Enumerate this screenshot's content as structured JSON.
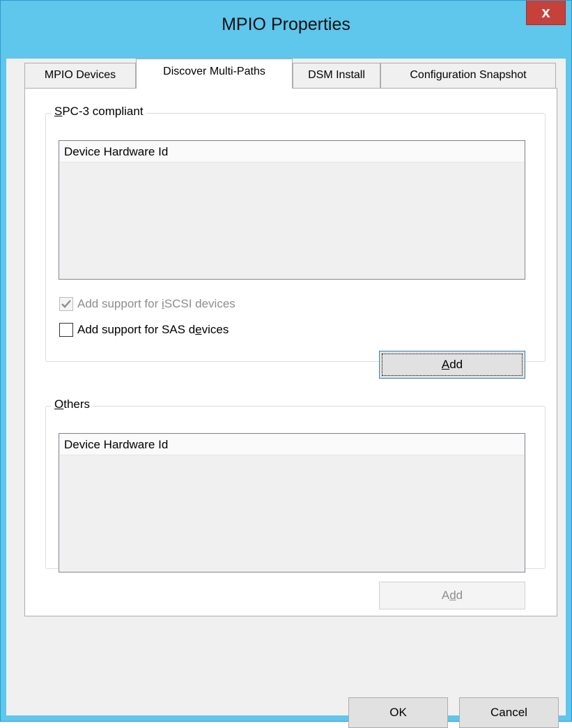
{
  "window": {
    "title": "MPIO Properties",
    "close_glyph": "x"
  },
  "tabs": [
    {
      "label": "MPIO Devices",
      "active": false
    },
    {
      "label": "Discover Multi-Paths",
      "active": true
    },
    {
      "label": "DSM Install",
      "active": false
    },
    {
      "label": "Configuration Snapshot",
      "active": false
    }
  ],
  "spc3": {
    "legend_prefix": "S",
    "legend_rest": "PC-3 compliant",
    "column_header": "Device Hardware Id",
    "iscsi_pre": "Add support for ",
    "iscsi_accel": "i",
    "iscsi_post": "SCSI devices",
    "iscsi_checked": true,
    "sas_pre": "Add support for SAS d",
    "sas_accel": "e",
    "sas_post": "vices",
    "sas_checked": false,
    "add_accel": "A",
    "add_rest": "dd"
  },
  "others": {
    "legend_prefix": "O",
    "legend_rest": "thers",
    "column_header": "Device Hardware Id",
    "add_pre": "A",
    "add_accel": "d",
    "add_post": "d"
  },
  "footer": {
    "ok_label": "OK",
    "cancel_label": "Cancel"
  },
  "icons": {
    "close": "close-icon",
    "checkmark": "checkmark-icon"
  }
}
